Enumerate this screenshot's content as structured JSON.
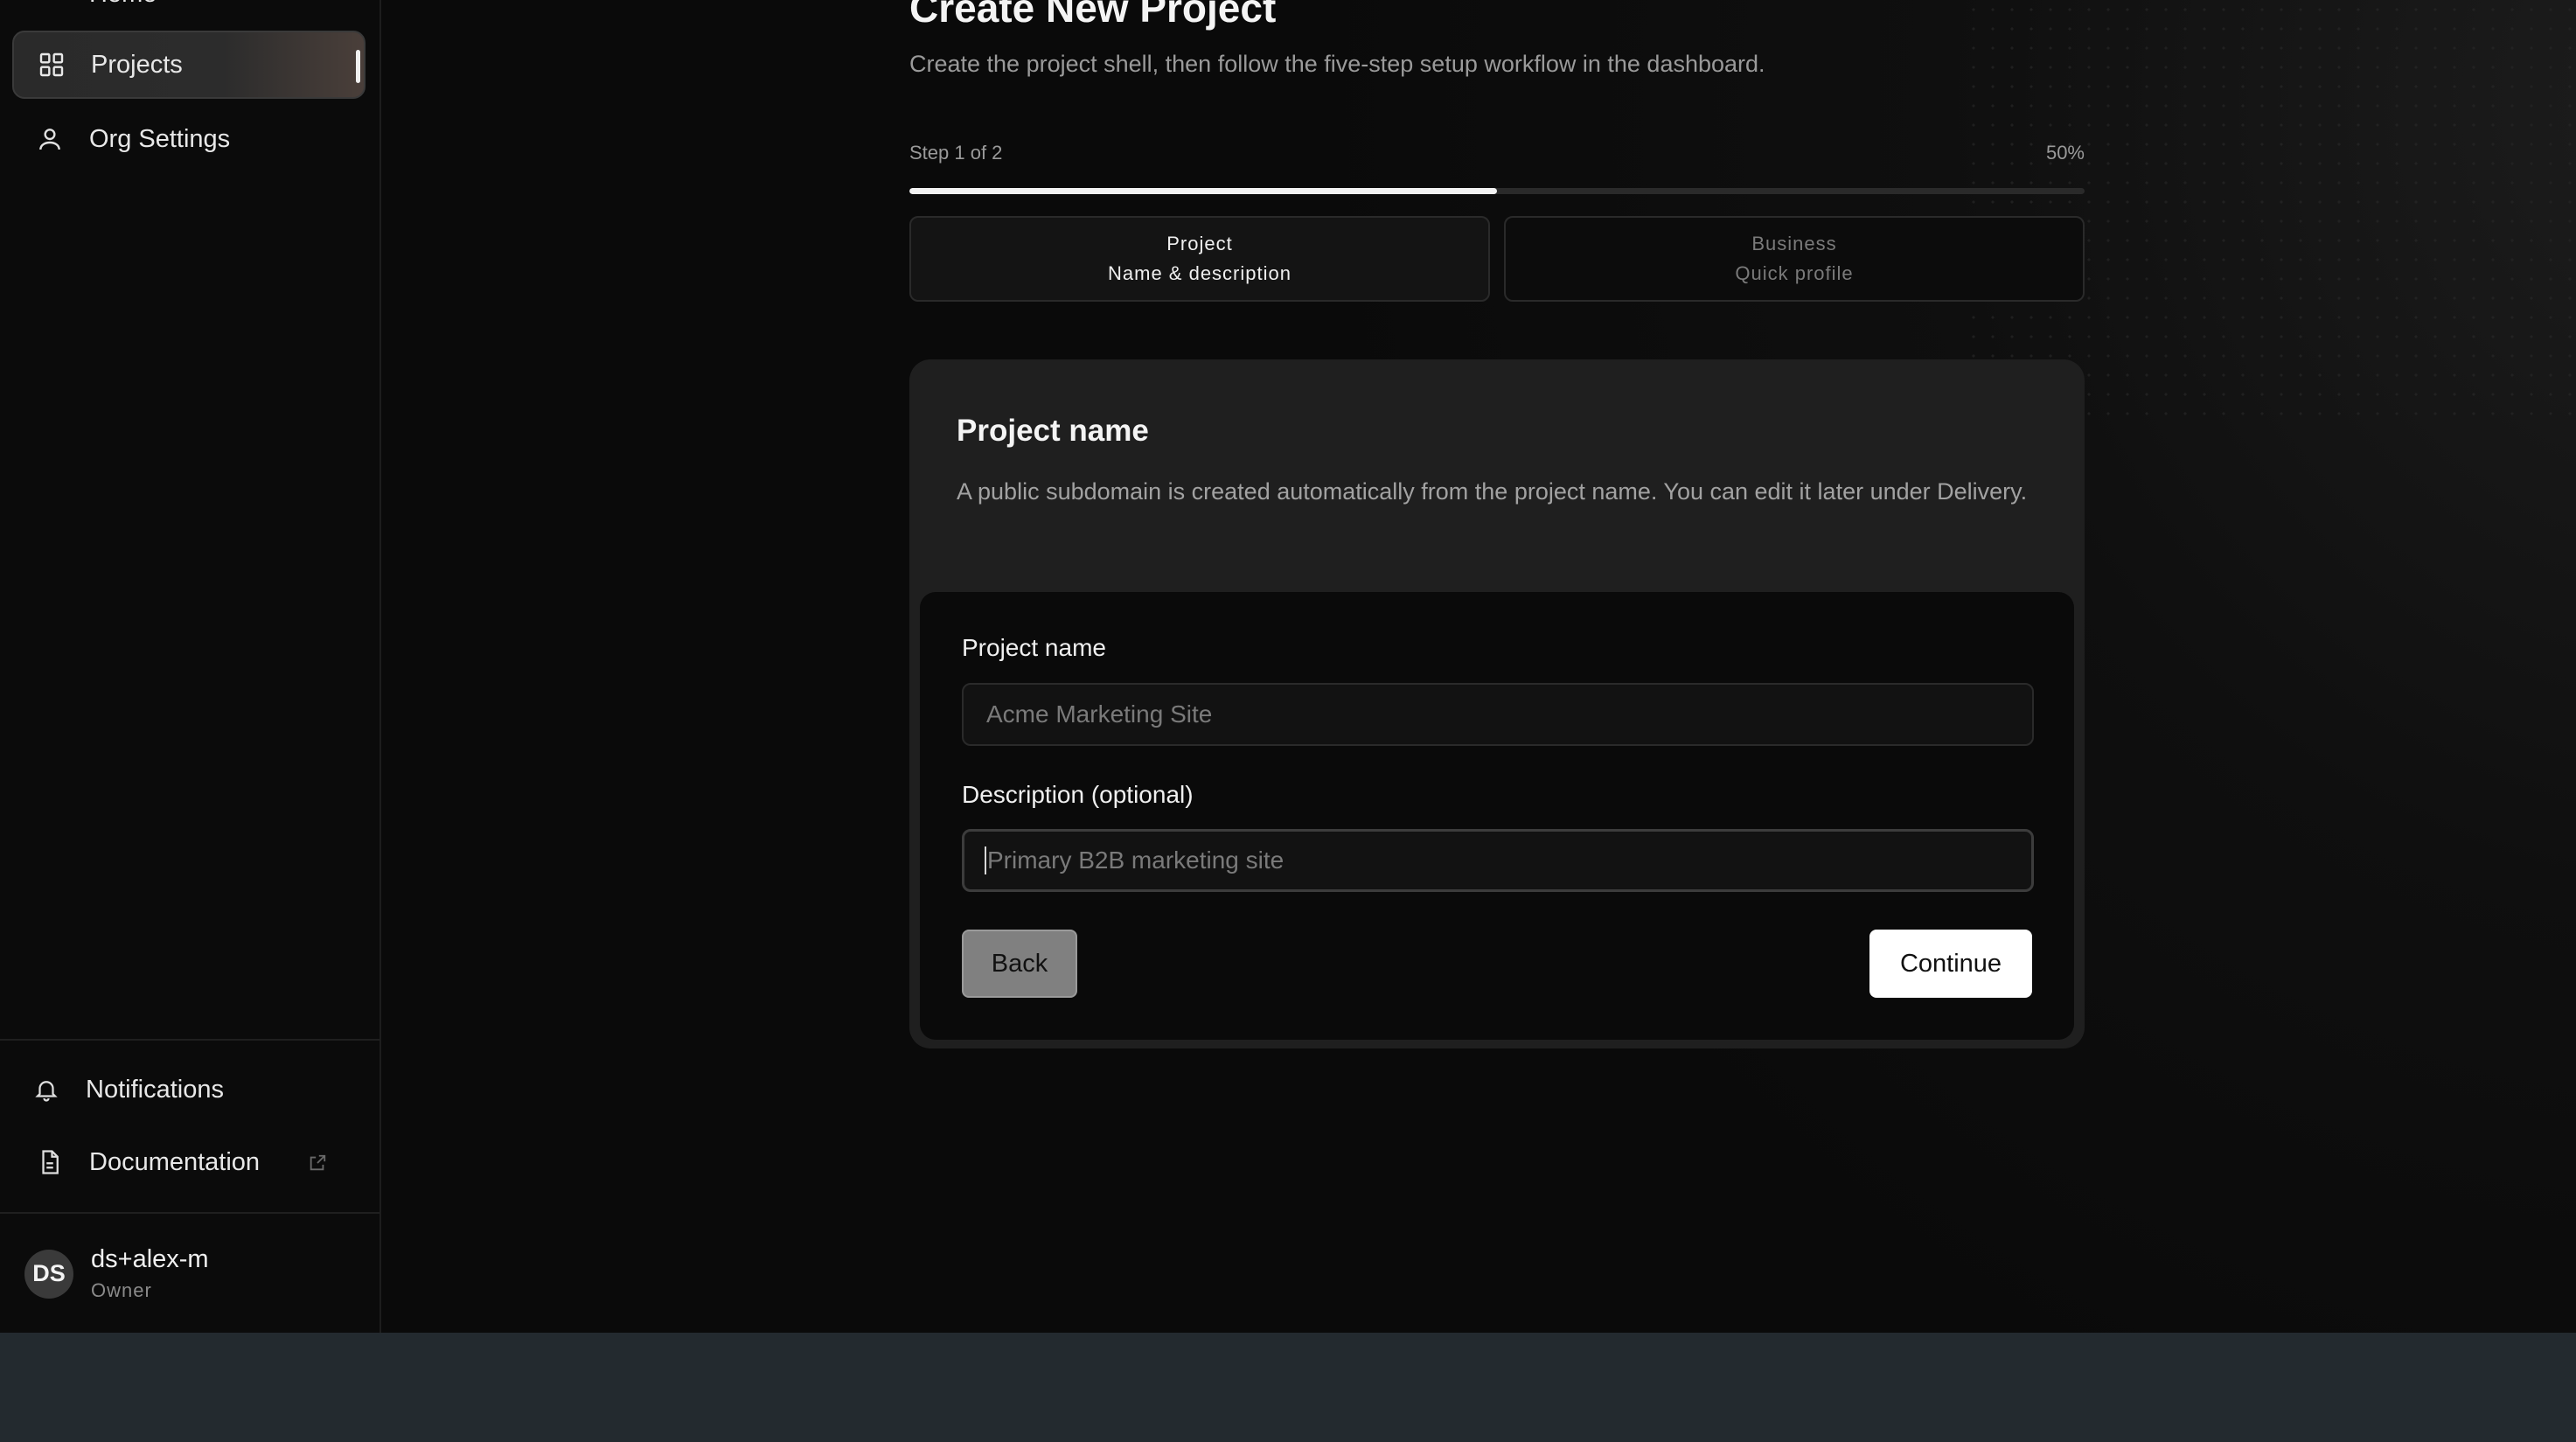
{
  "sidebar": {
    "home_label": "Home",
    "items": [
      {
        "label": "Projects",
        "icon": "grid-icon",
        "active": true
      },
      {
        "label": "Org Settings",
        "icon": "user-icon",
        "active": false
      }
    ],
    "bottom_items": [
      {
        "label": "Notifications",
        "icon": "bell-icon"
      },
      {
        "label": "Documentation",
        "icon": "document-icon",
        "external": true
      }
    ],
    "user": {
      "initials": "DS",
      "name": "ds+alex-m",
      "role": "Owner"
    }
  },
  "page": {
    "title": "Create New Project",
    "subtitle": "Create the project shell, then follow the five-step setup workflow in the dashboard."
  },
  "progress": {
    "step_label": "Step 1 of 2",
    "percent_label": "50%",
    "percent": 50
  },
  "steps": [
    {
      "title": "Project",
      "subtitle": "Name & description",
      "active": true
    },
    {
      "title": "Business",
      "subtitle": "Quick profile",
      "active": false
    }
  ],
  "card": {
    "title": "Project name",
    "description": "A public subdomain is created automatically from the project name. You can edit it later under Delivery."
  },
  "form": {
    "name_label": "Project name",
    "name_placeholder": "Acme Marketing Site",
    "description_label": "Description (optional)",
    "description_placeholder": "Primary B2B marketing site",
    "back_label": "Back",
    "continue_label": "Continue"
  },
  "colors": {
    "background": "#0a0a0a",
    "card": "#1f1f1f",
    "accent": "#ffffff",
    "bottom_bar": "#232a2f"
  }
}
